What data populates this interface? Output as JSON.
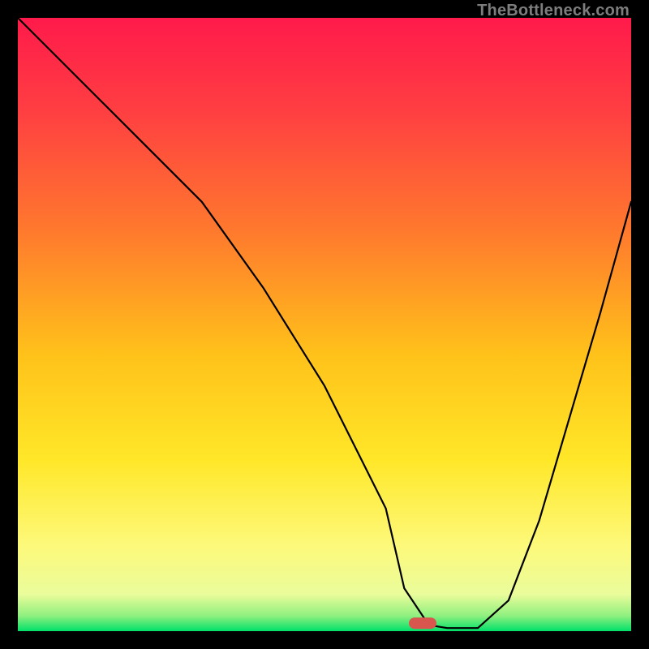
{
  "watermark": "TheBottleneck.com",
  "chart_data": {
    "type": "line",
    "title": "",
    "xlabel": "",
    "ylabel": "",
    "xlim": [
      0,
      100
    ],
    "ylim": [
      0,
      100
    ],
    "series": [
      {
        "name": "curve",
        "x": [
          0,
          10,
          20,
          30,
          40,
          50,
          60,
          63,
          67,
          70,
          75,
          80,
          85,
          90,
          95,
          100
        ],
        "y": [
          100,
          90,
          80,
          70,
          56,
          40,
          20,
          7,
          1,
          0.5,
          0.5,
          5,
          18,
          35,
          52,
          70
        ]
      }
    ],
    "marker": {
      "x": 66,
      "y": 1.3,
      "color": "#d9564f"
    },
    "gradient_stops": [
      {
        "offset": 0.0,
        "color": "#ff1a4b"
      },
      {
        "offset": 0.15,
        "color": "#ff3e42"
      },
      {
        "offset": 0.35,
        "color": "#ff7a2d"
      },
      {
        "offset": 0.55,
        "color": "#ffc21a"
      },
      {
        "offset": 0.72,
        "color": "#ffe728"
      },
      {
        "offset": 0.86,
        "color": "#fdf97a"
      },
      {
        "offset": 0.94,
        "color": "#eafc9b"
      },
      {
        "offset": 0.975,
        "color": "#8ff07f"
      },
      {
        "offset": 1.0,
        "color": "#00e06a"
      }
    ]
  }
}
